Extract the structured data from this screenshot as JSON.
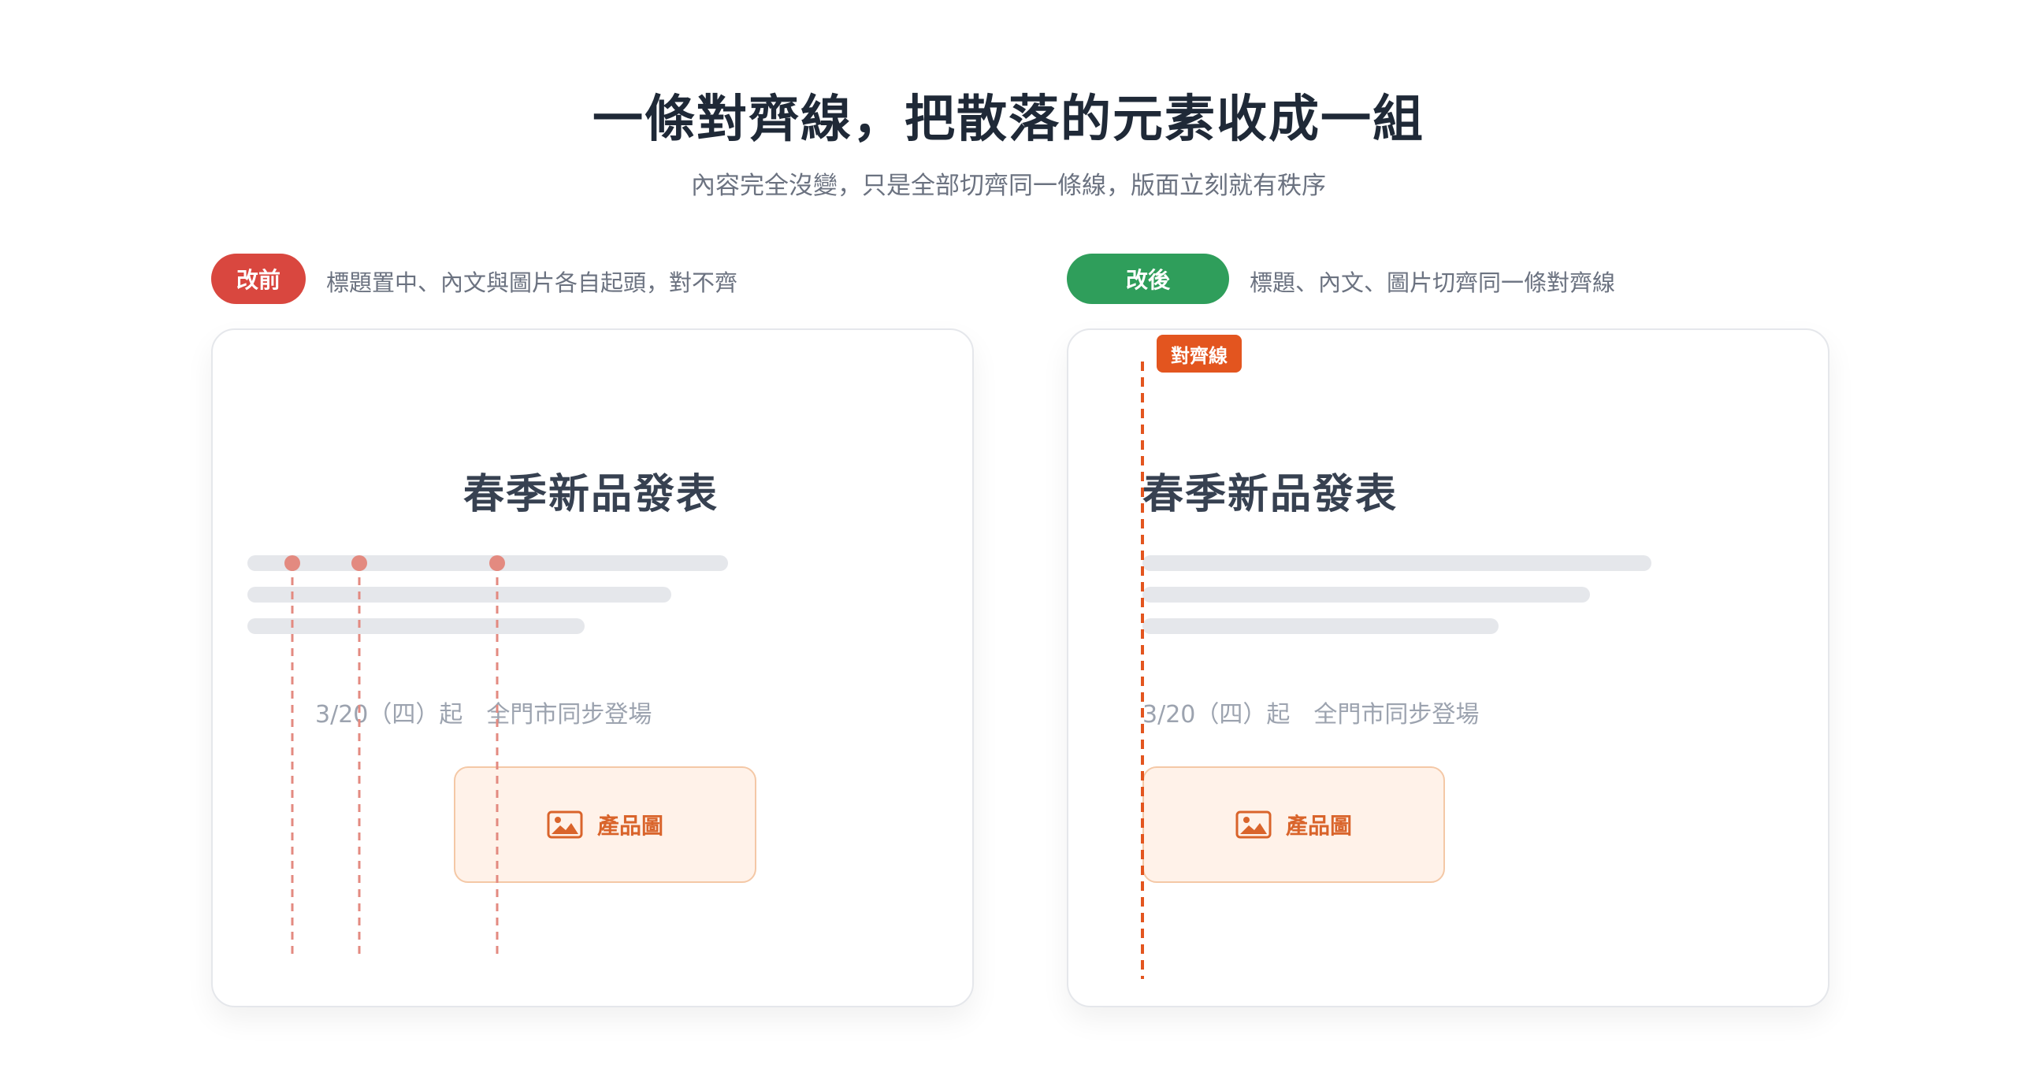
{
  "header": {
    "title": "一條對齊線，把散落的元素收成一組",
    "subtitle": "內容完全沒變，只是全部切齊同一條線，版面立刻就有秩序"
  },
  "before": {
    "badge": "改前",
    "description": "標題置中、內文與圖片各自起頭，對不齊",
    "card_title": "春季新品發表",
    "date_text": "3/20（四）起　全門市同步登場",
    "image_label": "產品圖"
  },
  "after": {
    "badge": "改後",
    "description": "標題、內文、圖片切齊同一條對齊線",
    "align_tag": "對齊線",
    "card_title": "春季新品發表",
    "date_text": "3/20（四）起　全門市同步登場",
    "image_label": "產品圖"
  },
  "colors": {
    "before_badge": "#d9473f",
    "after_badge": "#2f9e5b",
    "guide_before": "#e38a80",
    "guide_after": "#e3551f",
    "image_accent": "#d9642b"
  },
  "icons": {
    "image_placeholder": "image-icon"
  }
}
